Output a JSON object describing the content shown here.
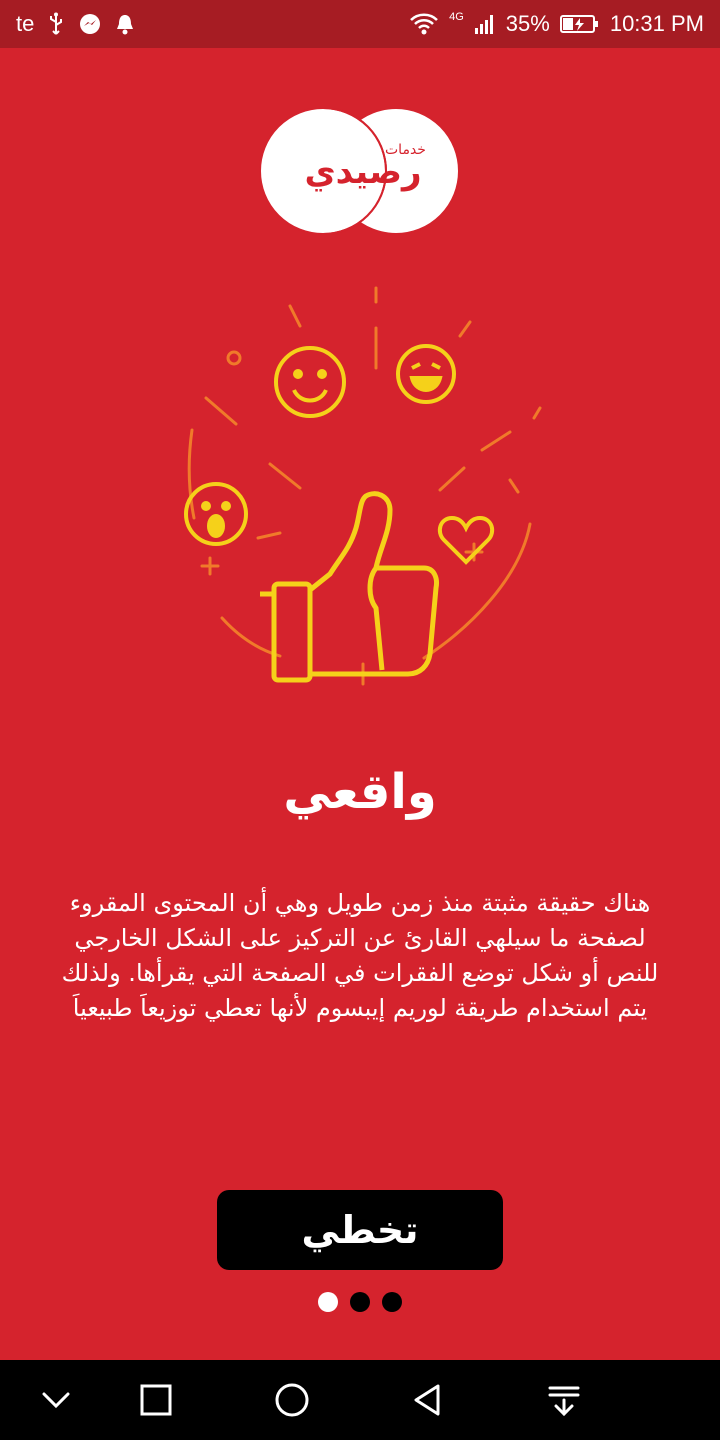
{
  "status_bar": {
    "carrier": "te",
    "network": "4G",
    "battery": "35%",
    "time": "10:31 PM"
  },
  "logo": {
    "top_text": "خدمات",
    "main_text": "رصيدي"
  },
  "onboarding": {
    "title": "واقعي",
    "description": "هناك حقيقة مثبتة منذ زمن طويل وهي أن المحتوى المقروء لصفحة ما سيلهي القارئ عن التركيز على الشكل الخارجي للنص أو شكل توضع الفقرات في الصفحة التي يقرأها. ولذلك يتم استخدام طريقة لوريم إيبسوم لأنها تعطي توزيعاَ طبيعياَ",
    "skip_label": "تخطي",
    "pages": 3,
    "current_page": 1
  },
  "colors": {
    "background": "#d5232d",
    "status_bar": "#a61c23",
    "button": "#000000",
    "icon_yellow": "#f5d11a",
    "icon_orange": "#f07a2a"
  },
  "nav_bar": {
    "icons": [
      "chevron-down-icon",
      "recents-square-icon",
      "home-circle-icon",
      "back-triangle-icon",
      "notification-pull-icon"
    ]
  }
}
